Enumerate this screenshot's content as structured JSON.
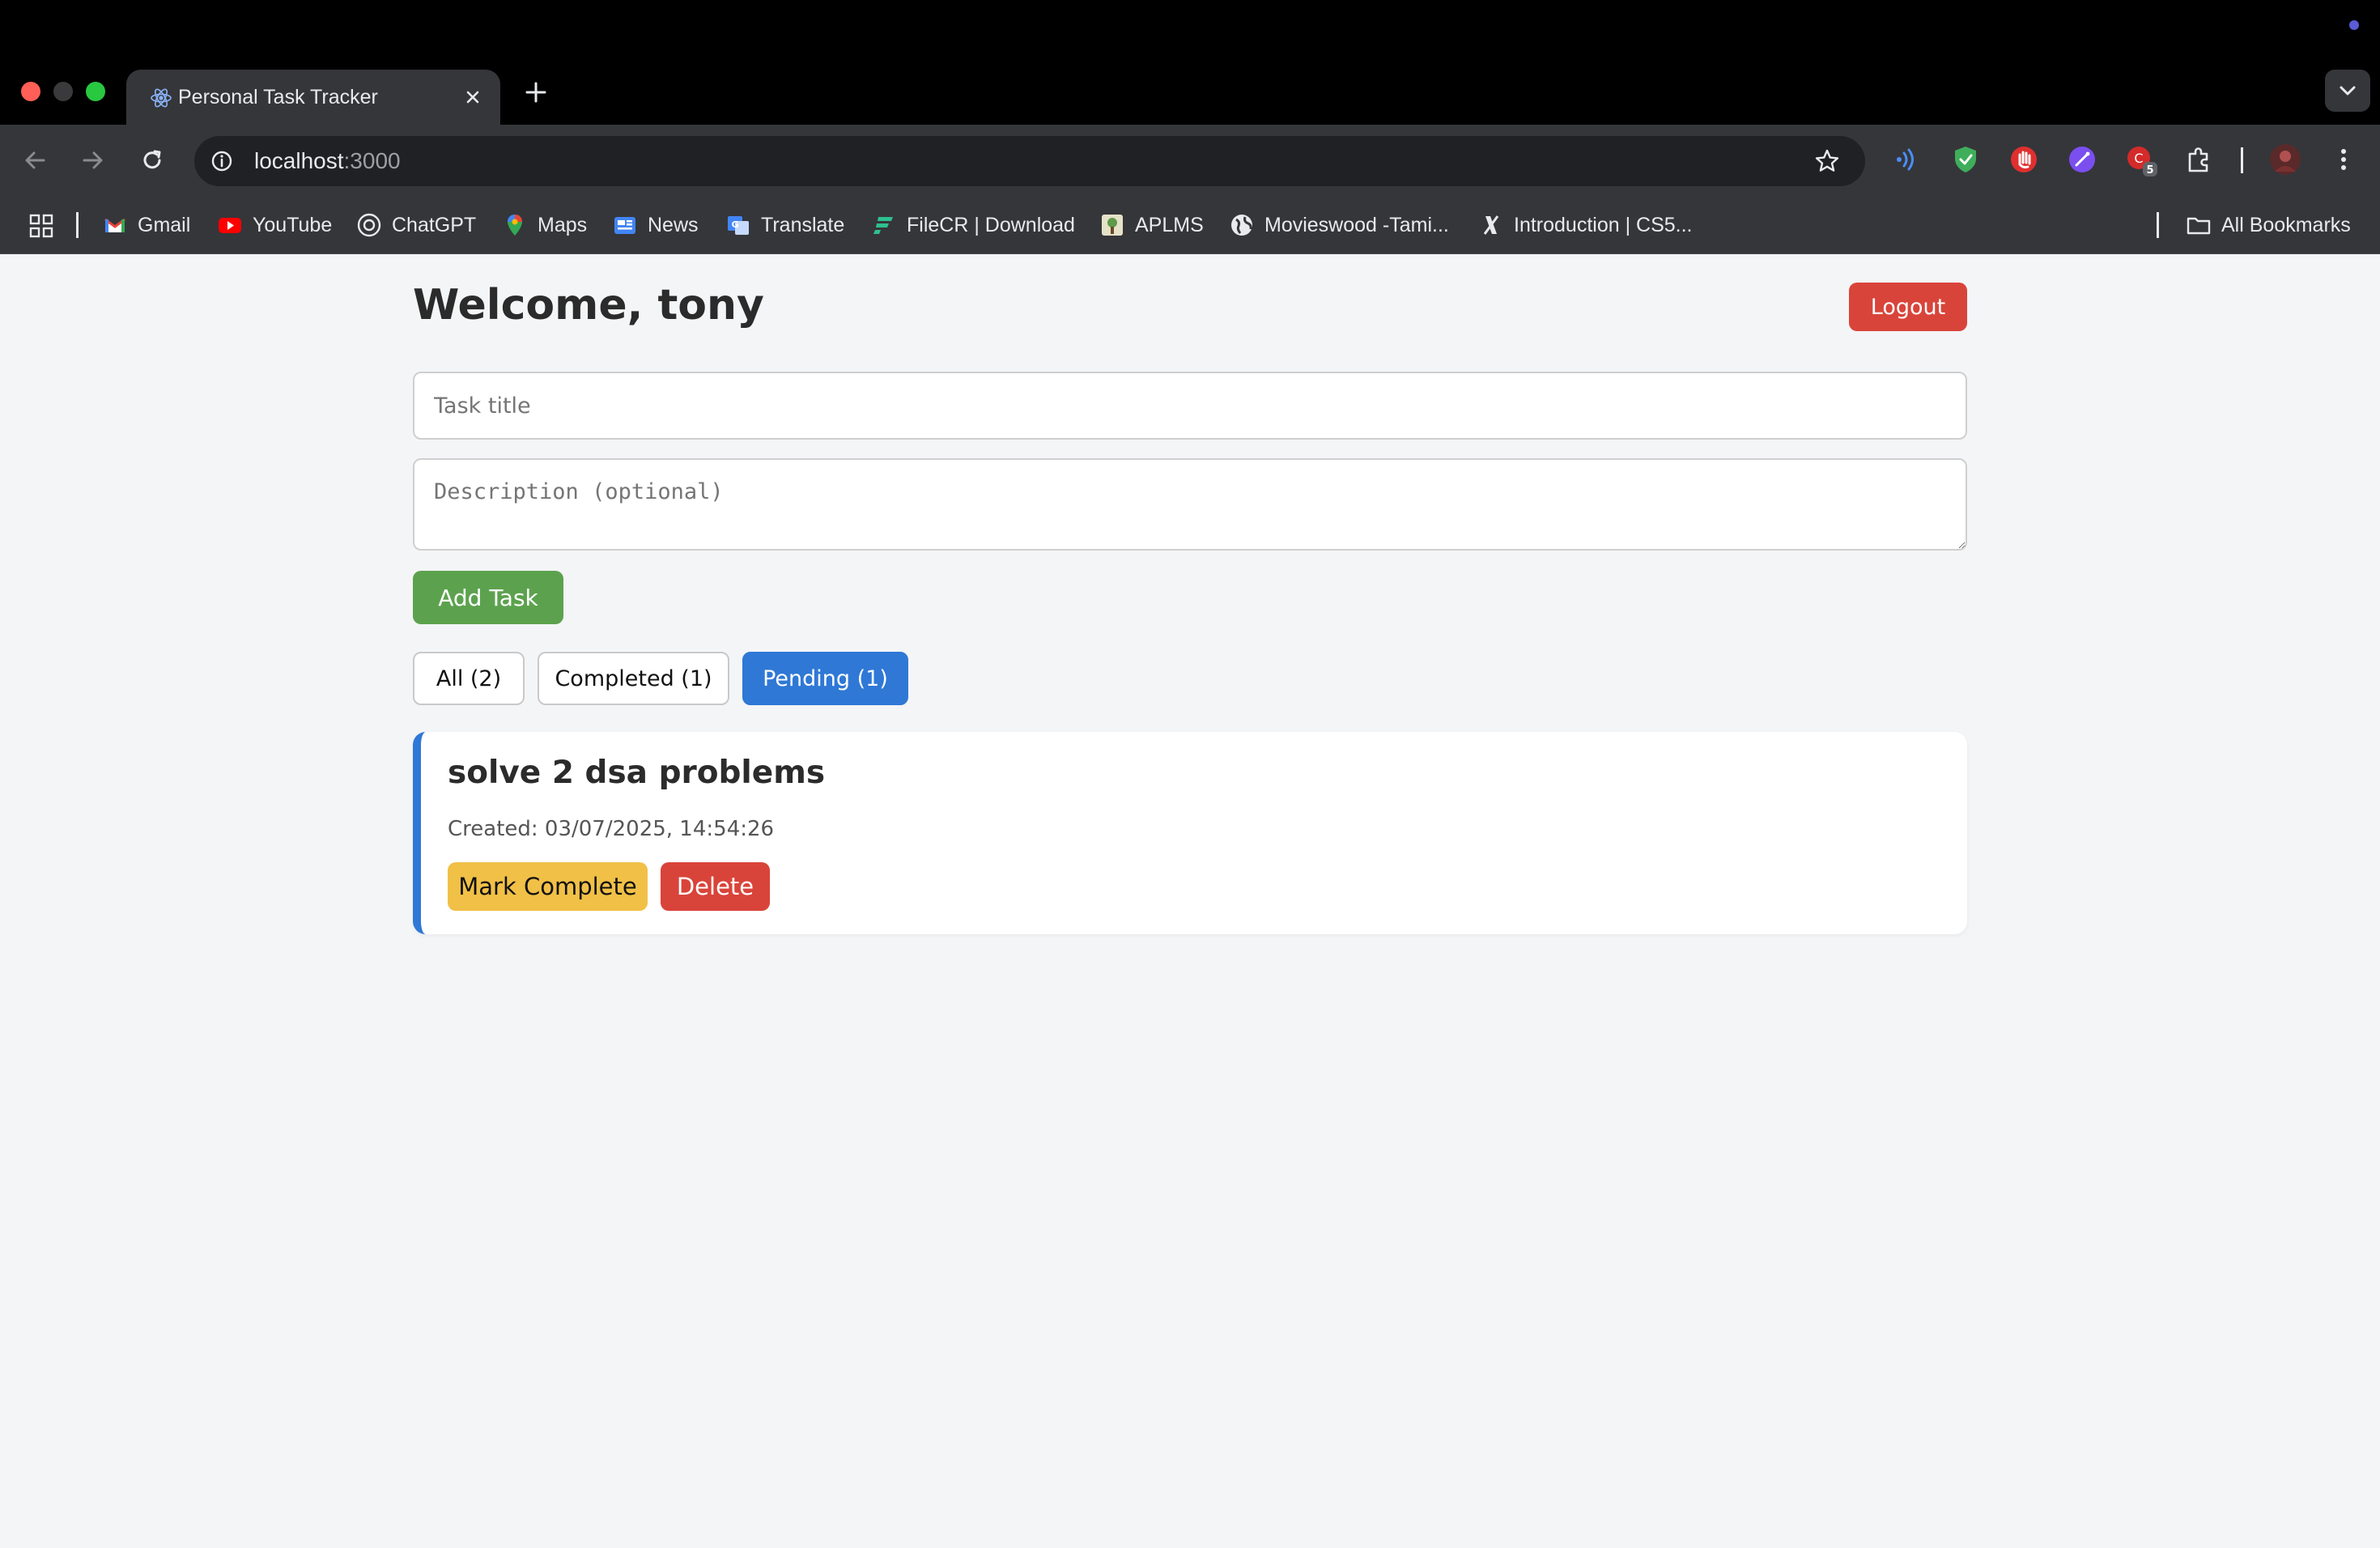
{
  "browser": {
    "tab_title": "Personal Task Tracker",
    "tab_icon": "react-logo-icon",
    "url_host": "localhost",
    "url_port": ":3000",
    "extension_badge_count": "5",
    "bookmarks": [
      {
        "label": "Gmail",
        "icon": "gmail-icon"
      },
      {
        "label": "YouTube",
        "icon": "youtube-icon"
      },
      {
        "label": "ChatGPT",
        "icon": "chatgpt-icon"
      },
      {
        "label": "Maps",
        "icon": "maps-icon"
      },
      {
        "label": "News",
        "icon": "news-icon"
      },
      {
        "label": "Translate",
        "icon": "translate-icon"
      },
      {
        "label": "FileCR | Download",
        "icon": "filecr-icon"
      },
      {
        "label": "APLMS",
        "icon": "aplms-icon"
      },
      {
        "label": "Movieswood -Tami...",
        "icon": "globe-icon"
      },
      {
        "label": "Introduction | CS5...",
        "icon": "x-icon"
      }
    ],
    "all_bookmarks_label": "All Bookmarks"
  },
  "app": {
    "welcome": "Welcome, tony",
    "logout_label": "Logout",
    "task_title_placeholder": "Task title",
    "description_placeholder": "Description (optional)",
    "add_task_label": "Add Task",
    "filters": [
      {
        "label": "All (2)",
        "active": false
      },
      {
        "label": "Completed (1)",
        "active": false
      },
      {
        "label": "Pending (1)",
        "active": true
      }
    ],
    "tasks": [
      {
        "title": "solve 2 dsa problems",
        "created": "Created: 03/07/2025, 14:54:26",
        "mark_complete_label": "Mark Complete",
        "delete_label": "Delete"
      }
    ]
  },
  "colors": {
    "accent_blue": "#2f78d6",
    "add_green": "#5ca24e",
    "danger_red": "#d9443a",
    "warning_yellow": "#f1c047",
    "page_bg": "#f4f5f7"
  }
}
